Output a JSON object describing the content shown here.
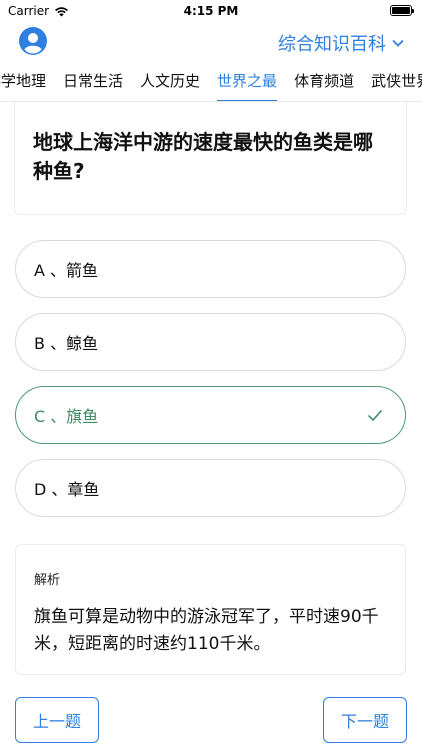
{
  "status_bar": {
    "carrier": "Carrier",
    "time": "4:15 PM"
  },
  "header": {
    "title": "综合知识百科"
  },
  "tabs": [
    {
      "label": "科学地理"
    },
    {
      "label": "日常生活"
    },
    {
      "label": "人文历史"
    },
    {
      "label": "世界之最",
      "active": true
    },
    {
      "label": "体育频道"
    },
    {
      "label": "武侠世界"
    }
  ],
  "question": {
    "text": "地球上海洋中游的速度最快的鱼类是哪种鱼?"
  },
  "options": [
    {
      "label": "A 、箭鱼"
    },
    {
      "label": "B 、鲸鱼"
    },
    {
      "label": "C 、旗鱼",
      "correct": true
    },
    {
      "label": "D 、章鱼"
    }
  ],
  "analysis": {
    "title": "解析",
    "text": "旗鱼可算是动物中的游泳冠军了，平时速90千米，短距离的时速约110千米。"
  },
  "buttons": {
    "prev": "上一题",
    "next": "下一题"
  },
  "colors": {
    "accent": "#2f7fe0",
    "correct": "#3d8b63"
  }
}
